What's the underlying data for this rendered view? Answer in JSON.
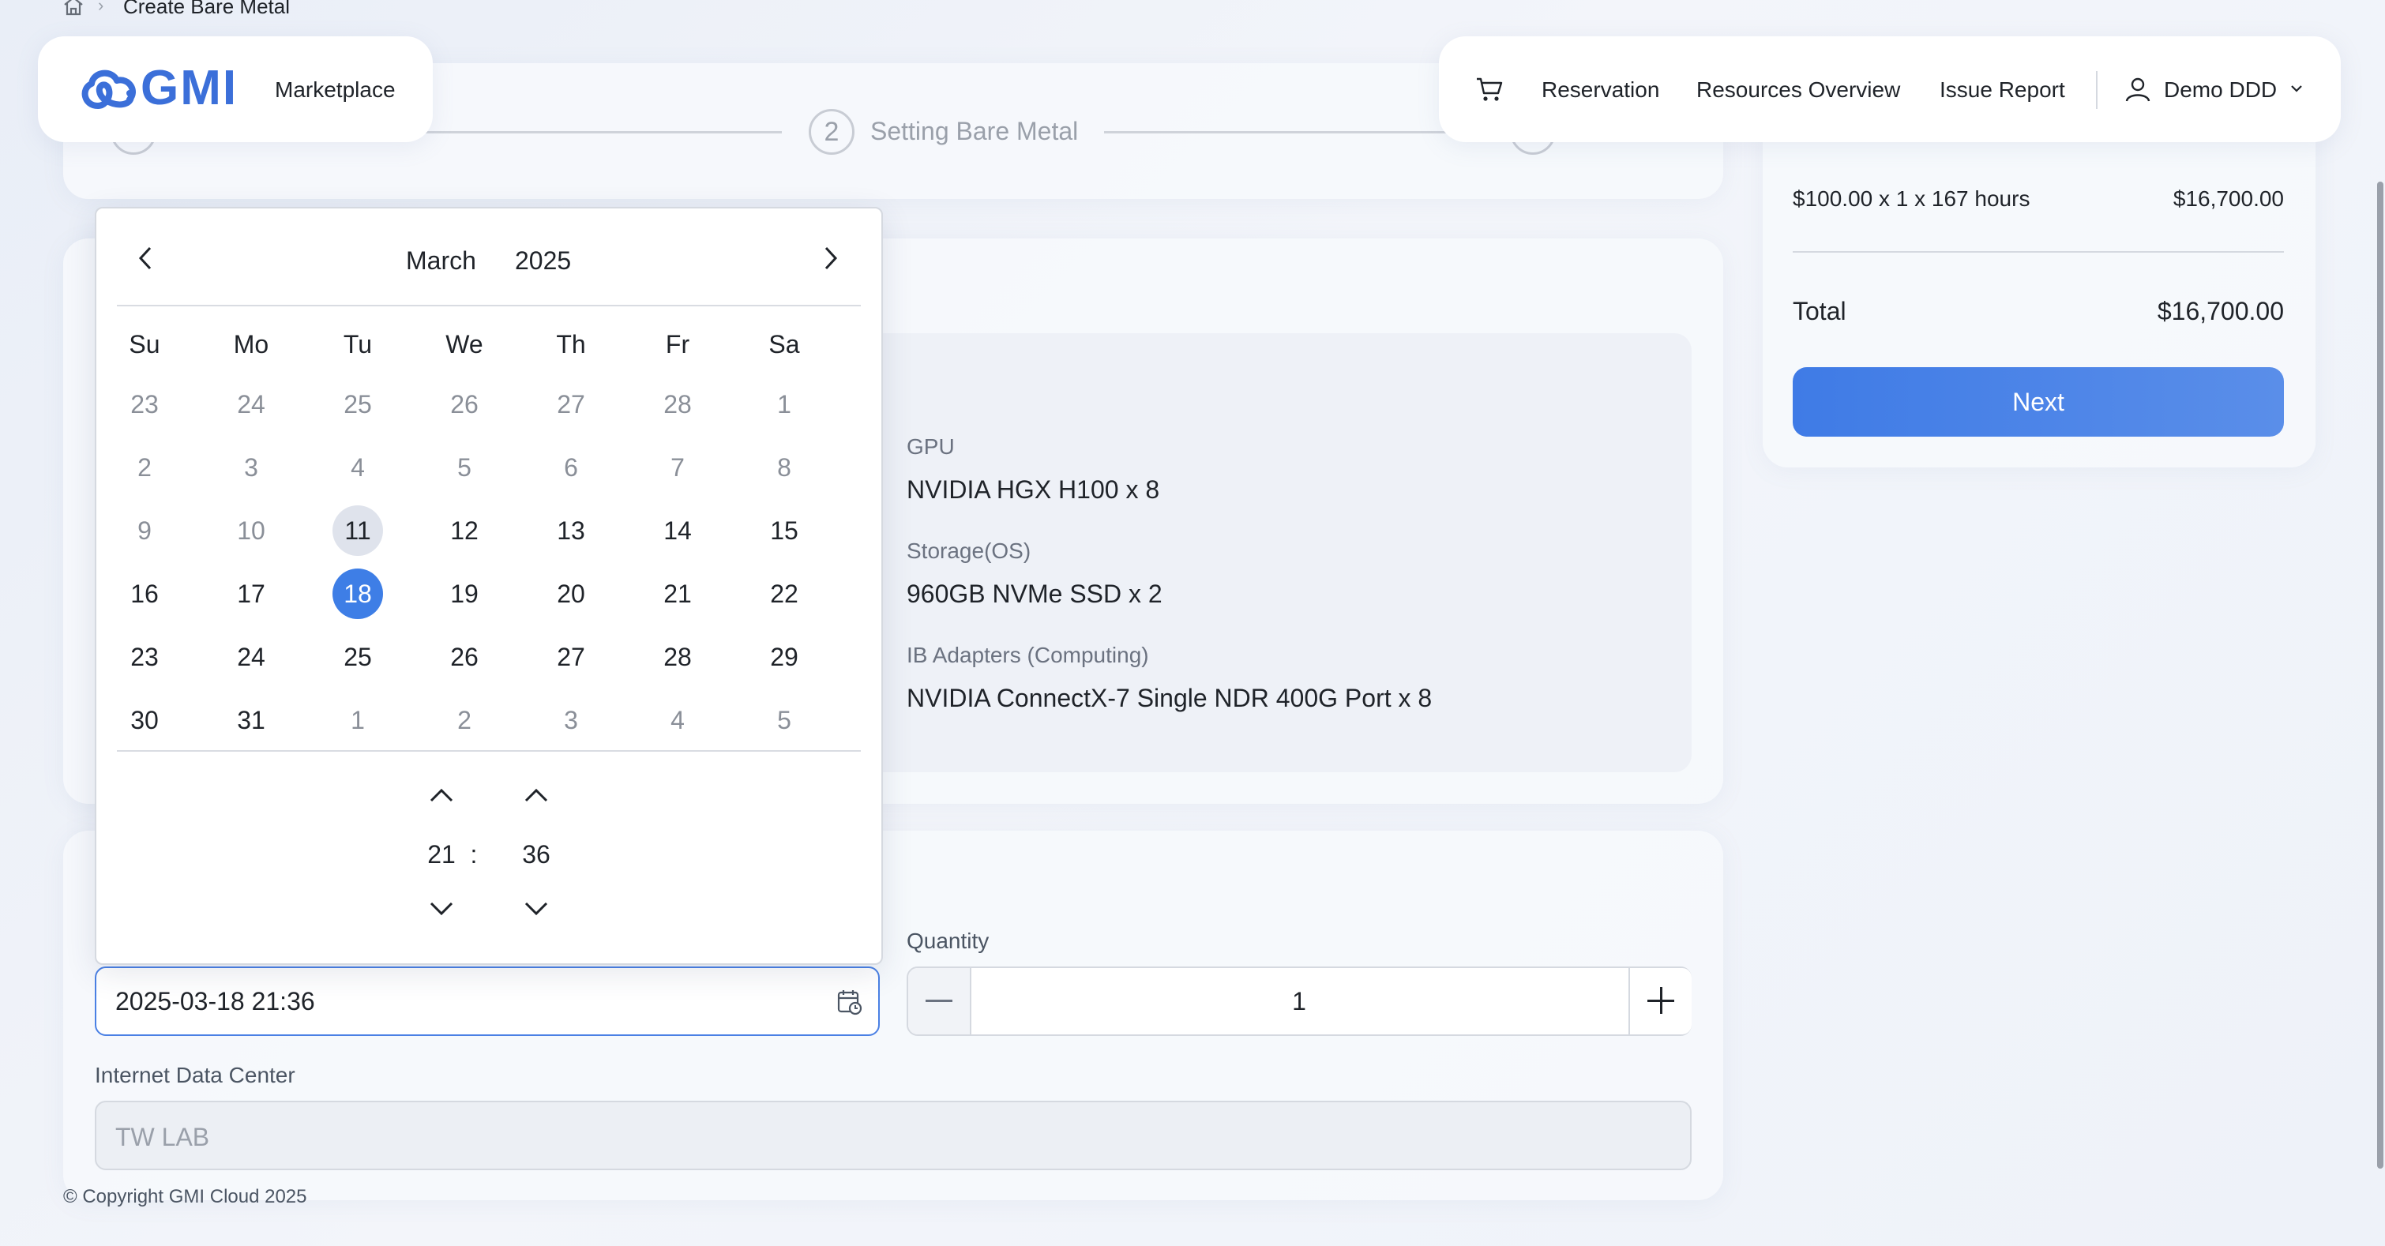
{
  "breadcrumb": {
    "current": "Create Bare Metal"
  },
  "header": {
    "brand": "GMI",
    "marketplace": "Marketplace",
    "nav": [
      "Reservation",
      "Resources Overview",
      "Issue Report"
    ],
    "user": "Demo DDD"
  },
  "steps": [
    {
      "number": "",
      "label": ""
    },
    {
      "number": "2",
      "label": "Setting Bare Metal"
    },
    {
      "number": "",
      "label": ""
    }
  ],
  "specs": [
    {
      "label": "GPU",
      "value": "NVIDIA HGX H100 x 8"
    },
    {
      "label": "Storage(OS)",
      "value": "960GB NVMe SSD x 2"
    },
    {
      "label": "IB Adapters (Computing)",
      "value": "NVIDIA ConnectX-7 Single NDR 400G Port x 8"
    }
  ],
  "calendar": {
    "month": "March",
    "year": "2025",
    "weekdays": [
      "Su",
      "Mo",
      "Tu",
      "We",
      "Th",
      "Fr",
      "Sa"
    ],
    "weeks": [
      [
        "23",
        "24",
        "25",
        "26",
        "27",
        "28",
        "1"
      ],
      [
        "2",
        "3",
        "4",
        "5",
        "6",
        "7",
        "8"
      ],
      [
        "9",
        "10",
        "11",
        "12",
        "13",
        "14",
        "15"
      ],
      [
        "16",
        "17",
        "18",
        "19",
        "20",
        "21",
        "22"
      ],
      [
        "23",
        "24",
        "25",
        "26",
        "27",
        "28",
        "29"
      ],
      [
        "30",
        "31",
        "1",
        "2",
        "3",
        "4",
        "5"
      ]
    ],
    "muted": [
      [
        0,
        1,
        2,
        3,
        4,
        5,
        6
      ],
      [
        0,
        1,
        2,
        3,
        4,
        5,
        6
      ],
      [
        0,
        1
      ],
      [],
      [],
      [
        2,
        3,
        4,
        5,
        6
      ]
    ],
    "today": "11",
    "selected": "18",
    "hour": "21",
    "minute": "36",
    "time_separator": ":"
  },
  "form": {
    "datetime_value": "2025-03-18 21:36",
    "quantity_label": "Quantity",
    "quantity_value": "1",
    "idc_label": "Internet Data Center",
    "idc_value": "TW LAB"
  },
  "price": {
    "line_item": "$100.00 x 1 x 167 hours",
    "line_amount": "$16,700.00",
    "total_label": "Total",
    "total_amount": "$16,700.00",
    "next_label": "Next"
  },
  "footer": {
    "copyright": "© Copyright GMI Cloud 2025"
  },
  "colors": {
    "accent": "#3e7ee6",
    "brand": "#3b6fd9"
  },
  "icons": [
    "home-icon",
    "chevron-right-icon",
    "cart-icon",
    "user-icon",
    "chevron-down-icon",
    "calendar-clock-icon",
    "minus-icon",
    "plus-icon"
  ]
}
